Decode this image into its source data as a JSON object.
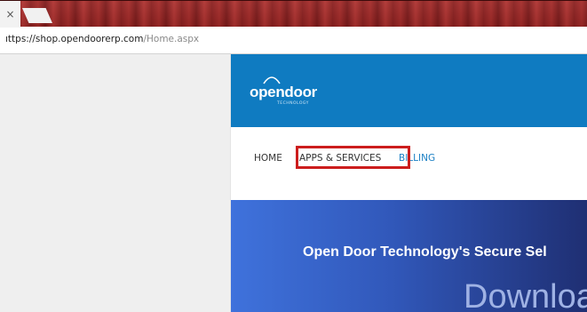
{
  "browser": {
    "close_glyph": "×",
    "url_host": "ıttps://shop.opendoorerp.com",
    "url_path": "/Home.aspx"
  },
  "site": {
    "logo_text": "opendoor",
    "logo_subtext": "TECHNOLOGY",
    "nav": {
      "home": "HOME",
      "apps_services": "APPS & SERVICES",
      "billing": "BILLING"
    },
    "banner": {
      "title": "Open Door Technology's Secure Sel",
      "subtitle": "Downloa"
    }
  },
  "colors": {
    "header_blue": "#0f7bc1",
    "highlight_red": "#cc1d1d",
    "billing_link": "#1a7fc4"
  }
}
